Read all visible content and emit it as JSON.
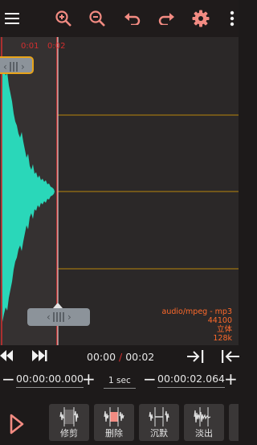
{
  "toolbar": {
    "icons": [
      "menu-icon",
      "zoom-in-icon",
      "zoom-out-icon",
      "undo-icon",
      "redo-icon",
      "gear-icon",
      "more-vert-icon"
    ],
    "icon_color": "#f28b82"
  },
  "waveform": {
    "time_marks": [
      "0:01",
      "0:02"
    ],
    "wave_color": "#2ad7b9",
    "gridline_color": "#b8860b",
    "marker_color": "#d32f2f",
    "format": "audio/mpeg - mp3",
    "sample_rate": "44100",
    "channels": "立体",
    "bitrate": "128k"
  },
  "transport": {
    "current_time": "00:00",
    "total_time": "00:02",
    "icons": [
      "skip-previous-icon",
      "skip-next-icon",
      "jump-to-start-marker-icon",
      "jump-to-end-marker-icon"
    ]
  },
  "selection": {
    "start_minus": "−",
    "start": "00:00:00.000",
    "start_plus": "+",
    "step": "1 sec",
    "end_minus": "−",
    "end": "00:00:02.064",
    "end_plus": "+"
  },
  "tools": [
    {
      "label": "修剪",
      "icon": "trim-icon"
    },
    {
      "label": "删除",
      "icon": "delete-icon"
    },
    {
      "label": "沉默",
      "icon": "silence-icon"
    },
    {
      "label": "淡出",
      "icon": "fade-out-icon"
    }
  ]
}
